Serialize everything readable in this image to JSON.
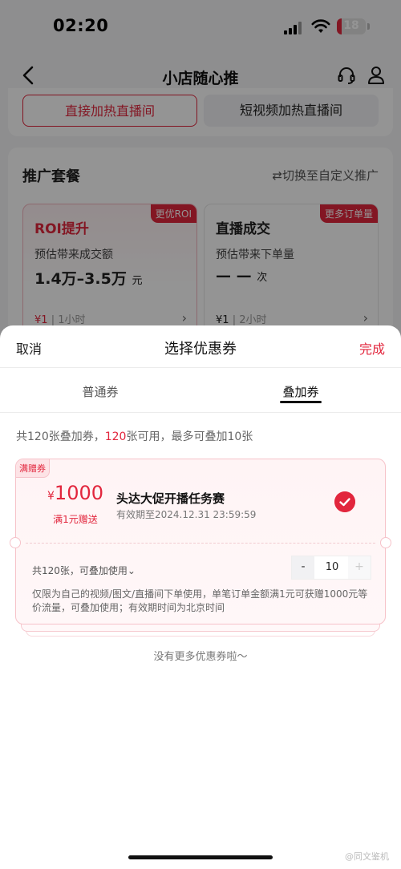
{
  "status_bar": {
    "time": "02:20",
    "battery": "18",
    "battery_level": 0.18,
    "accent": "#e2263d"
  },
  "nav": {
    "title": "小店随心推",
    "back_icon": "chevron-left-icon",
    "service_icon": "headset-icon",
    "profile_icon": "user-icon"
  },
  "segments": [
    {
      "label": "直接加热直播间",
      "active": true
    },
    {
      "label": "短视频加热直播间",
      "active": false
    }
  ],
  "packages": {
    "title": "推广套餐",
    "switch_label": "⇄切换至自定义推广",
    "items": [
      {
        "badge": "更优ROI",
        "name": "ROI提升",
        "desc": "预估带来成交额",
        "value": "1.4万–3.5万",
        "unit": "元",
        "price": "¥1",
        "duration": "1小时"
      },
      {
        "badge": "更多订单量",
        "name": "直播成交",
        "desc": "预估带来下单量",
        "value": "— —",
        "unit": "次",
        "price": "¥1",
        "duration": "2小时"
      }
    ]
  },
  "sheet": {
    "cancel": "取消",
    "title": "选择优惠券",
    "done": "完成",
    "tabs": [
      "普通券",
      "叠加券"
    ],
    "active_tab": "叠加券",
    "summary": {
      "prefix": "共120张叠加券，",
      "available": "120",
      "suffix": "张可用，最多可叠加10张"
    },
    "coupon": {
      "tag": "满赠券",
      "currency": "¥",
      "amount": "1000",
      "condition": "满1元赠送",
      "name": "头达大促开播任务赛",
      "expiry": "有效期至2024.12.31 23:59:59",
      "selected": true,
      "count_label": "共120张，可叠加使用⌄",
      "stepper": {
        "minus": "-",
        "value": "10",
        "plus": "+"
      },
      "description": "仅限为自己的视频/图文/直播间下单使用，单笔订单金额满1元可获赠1000元等价流量，可叠加使用；有效期时间为北京时间"
    },
    "no_more": "没有更多优惠券啦～"
  },
  "watermark": "@同文鉴机"
}
